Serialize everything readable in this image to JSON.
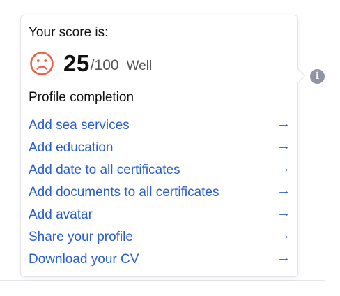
{
  "score": {
    "heading": "Your score is:",
    "value": "25",
    "max": "/100",
    "level": "Well",
    "mood_icon": "sad-face-icon",
    "mood_color": "#e8624a"
  },
  "completion": {
    "title": "Profile completion",
    "tasks": [
      {
        "label": "Add sea services",
        "arrow": "→"
      },
      {
        "label": "Add education",
        "arrow": "→"
      },
      {
        "label": "Add date to all certificates",
        "arrow": "→"
      },
      {
        "label": "Add documents to all certificates",
        "arrow": "→"
      },
      {
        "label": "Add avatar",
        "arrow": "→"
      },
      {
        "label": "Share your profile",
        "arrow": "→"
      },
      {
        "label": "Download your CV",
        "arrow": "→"
      }
    ]
  },
  "info_button": {
    "glyph": "i",
    "icon": "info-icon",
    "color": "#8e93a6"
  },
  "colors": {
    "link": "#2a5fc9",
    "text": "#111111",
    "muted": "#555555"
  }
}
